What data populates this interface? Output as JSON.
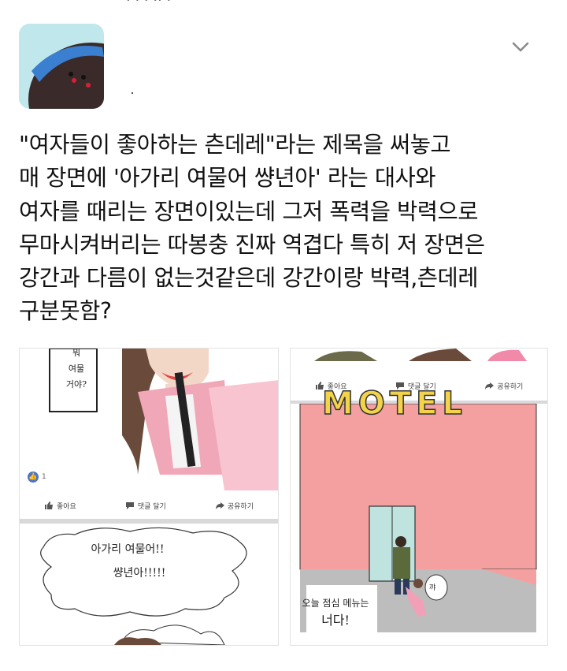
{
  "header": {
    "top_cut_text": "· ·  ·   ·· ·",
    "avatar_name": "avatar"
  },
  "tweet": {
    "lines": [
      "\"여자들이 좋아하는 츤데레\"라는 제목을 써놓고",
      "매 장면에 '아가리 여물어 썅년아' 라는 대사와",
      "여자를 때리는 장면이있는데 그저 폭력을 박력으로",
      "무마시켜버리는 따봉충 진짜 역겹다 특히 저 장면은",
      "강간과 다름이 없는것같은데 강간이랑 박력,츤데레",
      "구분못함?"
    ]
  },
  "image1": {
    "bubble_text": [
      "뭐",
      "여물",
      "거야?"
    ],
    "reaction_count": "1",
    "actions": [
      "좋아요",
      "댓글 달기",
      "공유하기"
    ],
    "shout_lines": [
      "아가리 여물어!!",
      "썅년아!!!!!"
    ]
  },
  "image2": {
    "actions": [
      "좋아요",
      "댓글 달기",
      "공유하기"
    ],
    "sign_text": "MOTEL",
    "caption_lines": [
      "오늘 점심 메뉴는",
      "너다!"
    ],
    "small_bubble": "꺄"
  },
  "colors": {
    "fb_blue": "#4a73c9",
    "pink_wall": "#f5a0a0",
    "avatar_bg": "#bfe7ec",
    "avatar_blob": "#3b2a2a",
    "avatar_hair": "#3a7fd0"
  }
}
